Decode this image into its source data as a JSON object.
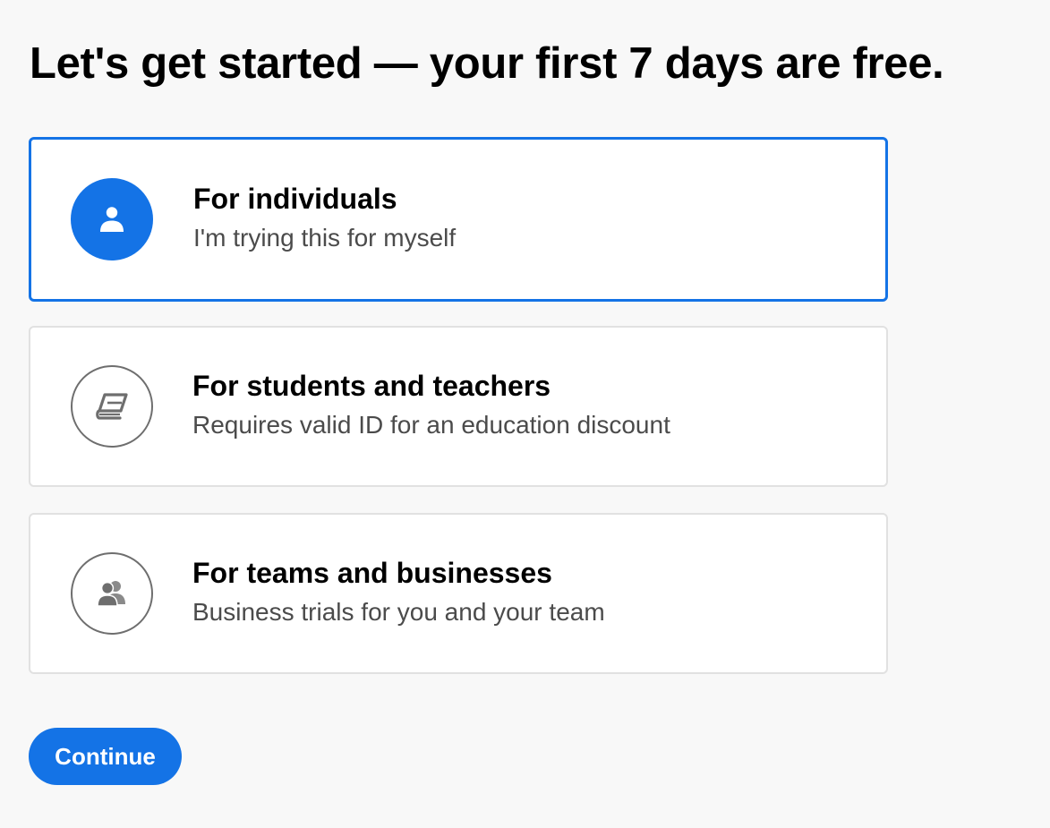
{
  "page": {
    "title": "Let's get started — your first 7 days are free."
  },
  "options": [
    {
      "title": "For individuals",
      "description": "I'm trying this for myself",
      "icon": "person-icon",
      "selected": true
    },
    {
      "title": "For students and teachers",
      "description": "Requires valid ID for an education discount",
      "icon": "book-icon",
      "selected": false
    },
    {
      "title": "For teams and businesses",
      "description": "Business trials for you and your team",
      "icon": "people-icon",
      "selected": false
    }
  ],
  "actions": {
    "continue_label": "Continue"
  },
  "colors": {
    "accent": "#1473e6",
    "background": "#f8f8f8",
    "card_border": "#e1e1e1",
    "icon_outline": "#6e6e6e"
  }
}
